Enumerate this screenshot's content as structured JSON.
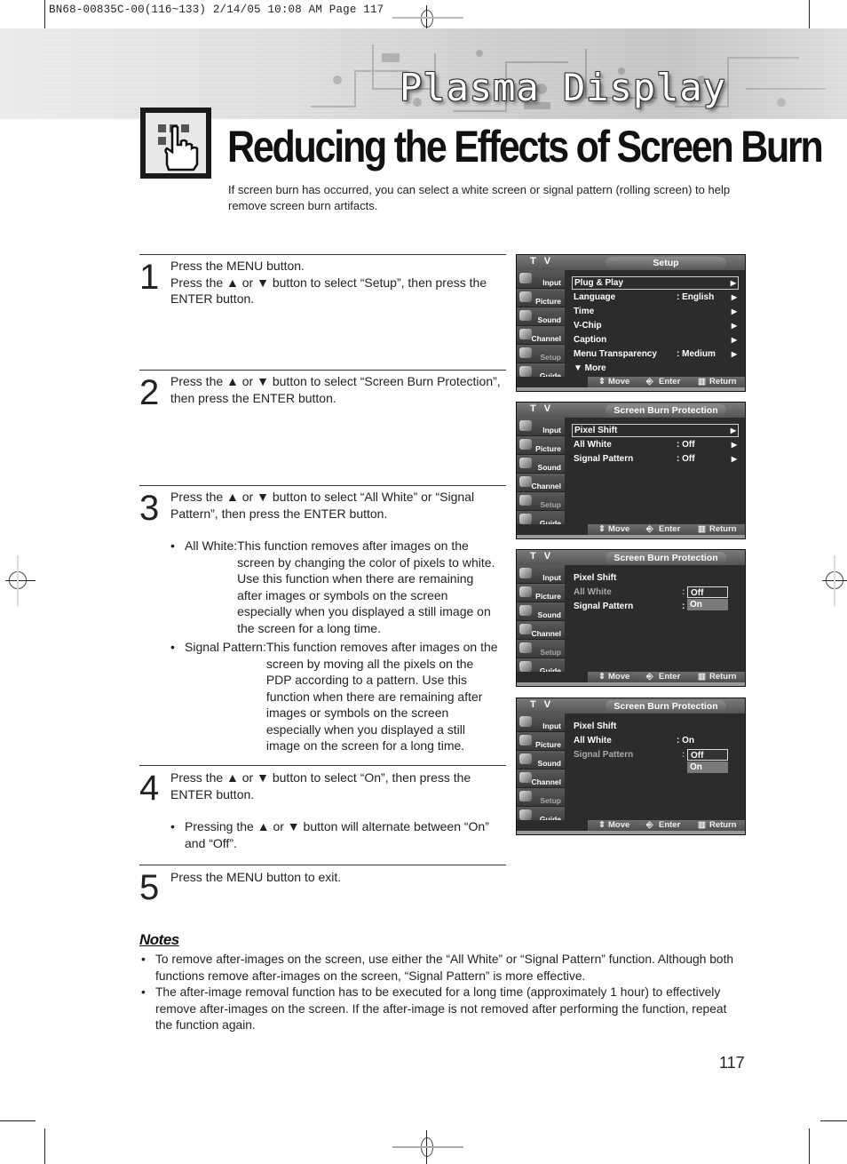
{
  "print_slug": "BN68-00835C-00(116~133)  2/14/05  10:08 AM  Page 117",
  "header": {
    "section_title": "Plasma Display",
    "page_title": "Reducing the Effects of Screen Burn",
    "intro": "If screen burn has occurred, you can select a white screen or signal pattern (rolling screen) to help remove screen burn artifacts.",
    "icon": "hand-pointer-icon"
  },
  "steps": [
    {
      "number": "1",
      "lines": [
        "Press the MENU button.",
        "Press the ▲ or ▼ button to select “Setup”, then press the ENTER button."
      ]
    },
    {
      "number": "2",
      "lines": [
        "Press the ▲ or ▼ button to select “Screen Burn Protection”, then press the ENTER button."
      ]
    },
    {
      "number": "3",
      "lines": [
        "Press the ▲ or ▼ button to select “All White” or “Signal Pattern”, then press the ENTER button."
      ],
      "bullets": [
        {
          "label": "All White: ",
          "text": "This function removes after images on the screen by changing the color of pixels to white. Use this function when there are remaining after images or symbols on the screen especially when you displayed a still image on the screen for a long time."
        },
        {
          "label": "Signal Pattern: ",
          "text": "This function removes after images on the screen by moving all the pixels on the PDP according to a pattern. Use this function when there are remaining after images or symbols on the screen especially when you displayed a still image on the screen for a long time."
        }
      ]
    },
    {
      "number": "4",
      "lines": [
        "Press the ▲ or ▼ button to select “On”, then press the ENTER button."
      ],
      "bullets": [
        {
          "label": "",
          "text": "Pressing the ▲ or ▼ button will alternate between “On” and “Off”."
        }
      ]
    },
    {
      "number": "5",
      "lines": [
        "Press the MENU button to exit."
      ]
    }
  ],
  "tv_common": {
    "label": "T V",
    "sidebar": [
      "Input",
      "Picture",
      "Sound",
      "Channel",
      "Setup",
      "Guide"
    ],
    "footer": {
      "move": "Move",
      "enter": "Enter",
      "return": "Return"
    },
    "more": "▼ More"
  },
  "screens": [
    {
      "title": "Setup",
      "rows": [
        {
          "name": "Plug & Play",
          "value": "",
          "arrow": "▶",
          "selected": true
        },
        {
          "name": "Language",
          "value": ": English",
          "arrow": "▶"
        },
        {
          "name": "Time",
          "value": "",
          "arrow": "▶"
        },
        {
          "name": "V-Chip",
          "value": "",
          "arrow": "▶"
        },
        {
          "name": "Caption",
          "value": "",
          "arrow": "▶"
        },
        {
          "name": "Menu Transparency",
          "value": ": Medium",
          "arrow": "▶"
        }
      ]
    },
    {
      "title": "Screen Burn Protection",
      "rows": [
        {
          "name": "Pixel Shift",
          "value": "",
          "arrow": "▶",
          "selected": true
        },
        {
          "name": "All White",
          "value": ": Off",
          "arrow": "▶"
        },
        {
          "name": "Signal Pattern",
          "value": ": Off",
          "arrow": "▶"
        }
      ]
    },
    {
      "title": "Screen Burn Protection",
      "rows": [
        {
          "name": "Pixel Shift",
          "value": ""
        },
        {
          "name": "All White",
          "value": ":",
          "dim": true
        },
        {
          "name": "Signal Pattern",
          "value": ":"
        }
      ],
      "dropdown": {
        "current": "Off",
        "option": "On"
      }
    },
    {
      "title": "Screen Burn Protection",
      "rows": [
        {
          "name": "Pixel Shift",
          "value": ""
        },
        {
          "name": "All White",
          "value": ": On"
        },
        {
          "name": "Signal Pattern",
          "value": ":",
          "dim": true
        }
      ],
      "dropdown": {
        "current": "Off",
        "option": "On"
      }
    }
  ],
  "notes": {
    "title": "Notes",
    "items": [
      "To remove after-images on the screen, use either the “All White” or “Signal Pattern” function. Although both functions remove after-images on the screen, “Signal Pattern” is more effective.",
      "The after-image removal function has to be executed for a long time (approximately 1 hour) to effectively remove after-images on the screen. If the after-image is not removed after performing the function, repeat the function again."
    ]
  },
  "page_number": "117"
}
